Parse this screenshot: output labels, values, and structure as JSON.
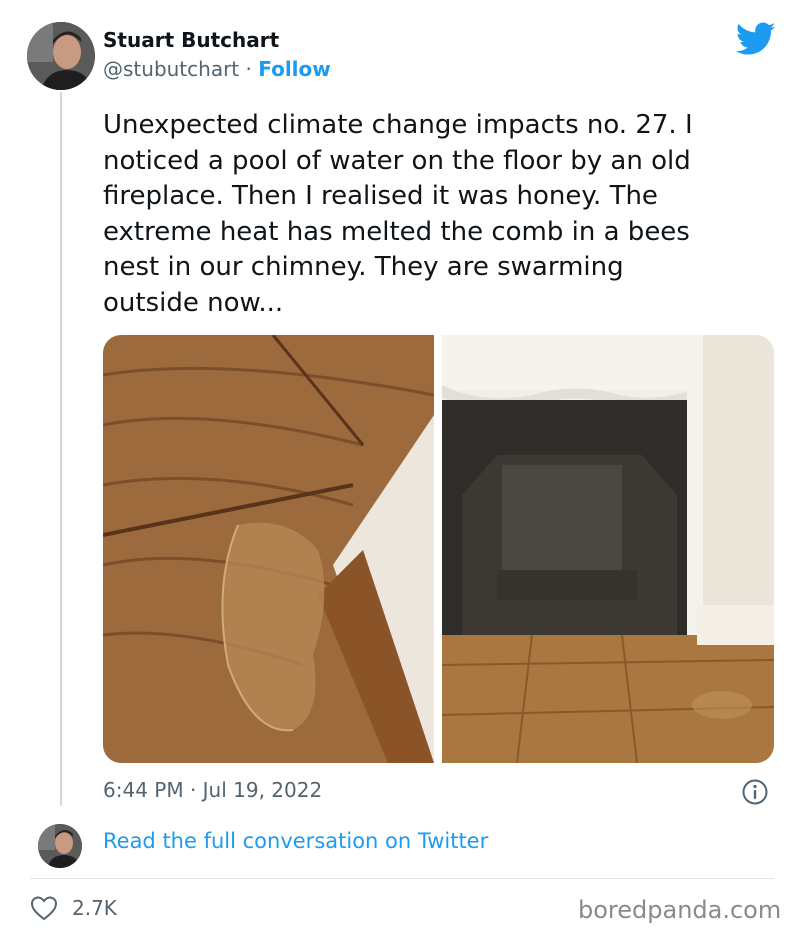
{
  "tweet": {
    "author_name": "Stuart Butchart",
    "handle": "@stubutchart",
    "separator": " · ",
    "follow_label": "Follow",
    "text": "Unexpected climate change impacts no. 27. I\nnoticed a pool of water on the floor by an old\nfireplace. Then I realised it was honey. The\nextreme heat has melted the comb in a bees\nnest in our chimney. They are swarming\noutside now...",
    "timestamp": "6:44 PM · Jul 19, 2022",
    "read_link": "Read the full conversation on Twitter",
    "like_count": "2.7K"
  },
  "icons": {
    "brand": "twitter-bird-icon",
    "info": "info-icon",
    "like": "heart-icon"
  },
  "colors": {
    "link_blue": "#1d9bf0",
    "muted_text": "#536471"
  },
  "watermark": "boredpanda.com"
}
